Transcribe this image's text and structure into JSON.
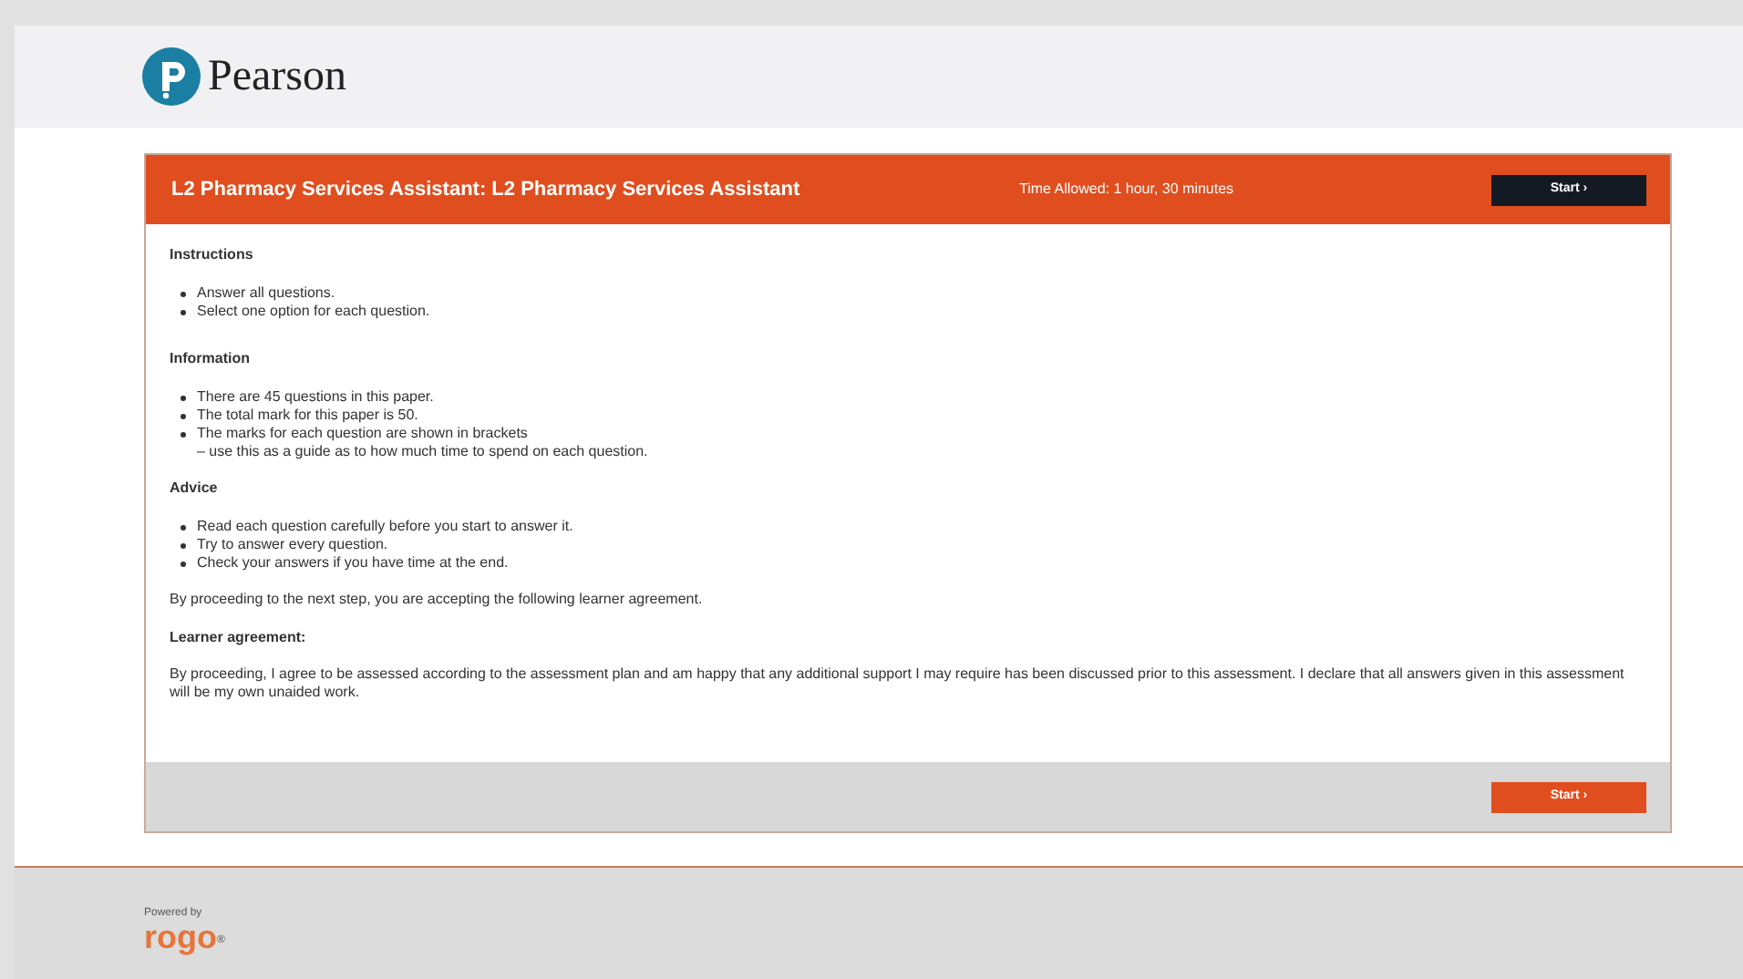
{
  "brand": {
    "name": "Pearson"
  },
  "exam": {
    "title": "L2 Pharmacy Services Assistant: L2 Pharmacy Services Assistant",
    "time_allowed": "Time Allowed: 1 hour, 30 minutes",
    "start_top": "Start ›",
    "start_bottom": "Start ›"
  },
  "sections": [
    {
      "heading": "Instructions",
      "items": [
        {
          "text": "Answer all questions."
        },
        {
          "text": "Select one option for each question."
        }
      ]
    },
    {
      "heading": "Information",
      "items": [
        {
          "text": "There are 45 questions in this paper."
        },
        {
          "text": "The total mark for this paper is 50."
        },
        {
          "text": "The marks for each question are shown in brackets",
          "note": "– use this as a guide as to how much time to spend on each question."
        }
      ]
    },
    {
      "heading": "Advice",
      "items": [
        {
          "text": "Read each question carefully before you start to answer it."
        },
        {
          "text": "Try to answer every question."
        },
        {
          "text": "Check your answers if you have time at the end."
        }
      ]
    }
  ],
  "proceed_note": "By proceeding to the next step, you are accepting the following learner agreement.",
  "agreement": {
    "heading": "Learner agreement:",
    "text": "By proceeding, I agree to be assessed according to the assessment plan and am happy that any additional support I may require has been discussed prior to this assessment. I declare that all answers given in this assessment will be my own unaided work."
  },
  "footer": {
    "powered_by": "Powered by",
    "logo": "rogo",
    "logo_mark": "®"
  }
}
